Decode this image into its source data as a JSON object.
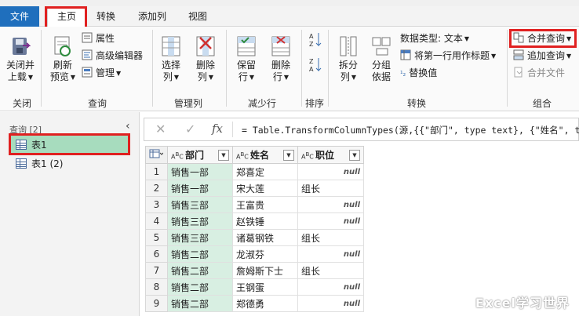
{
  "menu": {
    "file": "文件",
    "tabs": [
      "主页",
      "转换",
      "添加列",
      "视图"
    ]
  },
  "ribbon": {
    "close_load": [
      "关闭并",
      "上载"
    ],
    "refresh": [
      "刷新",
      "预览"
    ],
    "properties": "属性",
    "advanced_editor": "高级编辑器",
    "manage": "管理",
    "choose_cols": [
      "选择",
      "列"
    ],
    "remove_cols": [
      "删除",
      "列"
    ],
    "keep_rows": [
      "保留",
      "行"
    ],
    "remove_rows": [
      "删除",
      "行"
    ],
    "split_col": [
      "拆分",
      "列"
    ],
    "group_by": [
      "分组",
      "依据"
    ],
    "data_type": "数据类型: 文本",
    "first_row_header": "将第一行用作标题",
    "replace_values": "替换值",
    "merge_queries": "合并查询",
    "append_queries": "追加查询",
    "combine_files": "合并文件",
    "groups": [
      "关闭",
      "查询",
      "管理列",
      "减少行",
      "排序",
      "转换",
      "组合"
    ]
  },
  "queries": {
    "header": "查询 [2]",
    "items": [
      "表1",
      "表1 (2)"
    ]
  },
  "formula": "= Table.TransformColumnTypes(源,{{\"部门\", type text}, {\"姓名\", type",
  "columns": [
    "部门",
    "姓名",
    "职位"
  ],
  "rows": [
    {
      "n": "1",
      "dept": "销售一部",
      "name": "郑喜定",
      "pos": "null"
    },
    {
      "n": "2",
      "dept": "销售一部",
      "name": "宋大莲",
      "pos": "组长"
    },
    {
      "n": "3",
      "dept": "销售三部",
      "name": "王富贵",
      "pos": "null"
    },
    {
      "n": "4",
      "dept": "销售三部",
      "name": "赵铁锤",
      "pos": "null"
    },
    {
      "n": "5",
      "dept": "销售三部",
      "name": "诸葛钢铁",
      "pos": "组长"
    },
    {
      "n": "6",
      "dept": "销售二部",
      "name": "龙淑芬",
      "pos": "null"
    },
    {
      "n": "7",
      "dept": "销售二部",
      "name": "詹姆斯下士",
      "pos": "组长"
    },
    {
      "n": "8",
      "dept": "销售二部",
      "name": "王钢蛋",
      "pos": "null"
    },
    {
      "n": "9",
      "dept": "销售二部",
      "name": "郑德勇",
      "pos": "null"
    }
  ],
  "watermark": "Excel学习世界",
  "colors": {
    "accent": "#1f6fbd",
    "highlight": "#e02020",
    "selected": "#a7dcbe"
  }
}
